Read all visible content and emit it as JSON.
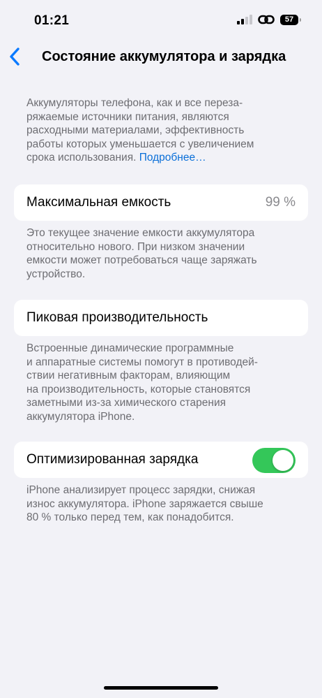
{
  "status_bar": {
    "time": "01:21",
    "battery": "57"
  },
  "nav": {
    "title": "Состояние аккумулятора и зарядка"
  },
  "intro": {
    "line1": "Аккумуляторы телефона, как и все переза-",
    "line2": "ряжаемые источники питания, являются",
    "line3": "расходными материалами, эффективность",
    "line4": "работы которых уменьшается с увеличением",
    "line5": "срока использования.",
    "link": "Подробнее…"
  },
  "max_capacity": {
    "label": "Максимальная емкость",
    "value": "99 %",
    "note": [
      "Это текущее значение емкости аккумулятора",
      "относительно нового. При низком значении",
      "емкости может потребоваться чаще заряжать",
      "устройство."
    ]
  },
  "peak_performance": {
    "label": "Пиковая производительность",
    "note": [
      "Встроенные динамические программные",
      "и аппаратные системы помогут в противодей-",
      "ствии негативным факторам, влияющим",
      "на производительность, которые становятся",
      "заметными из-за химического старения",
      "аккумулятора iPhone."
    ]
  },
  "optimized_charging": {
    "label": "Оптимизированная зарядка",
    "enabled": true,
    "note": [
      "iPhone анализирует процесс зарядки, снижая",
      "износ аккумулятора. iPhone заряжается свыше",
      "80 % только перед тем, как понадобится."
    ]
  },
  "colors": {
    "background": "#f2f2f7",
    "accent_link": "#0a6fd8",
    "toggle_on": "#34c759",
    "secondary_text": "#6d6d72"
  },
  "icons": [
    "back-chevron-icon",
    "cellular-signal-icon",
    "link-icon",
    "battery-icon"
  ]
}
